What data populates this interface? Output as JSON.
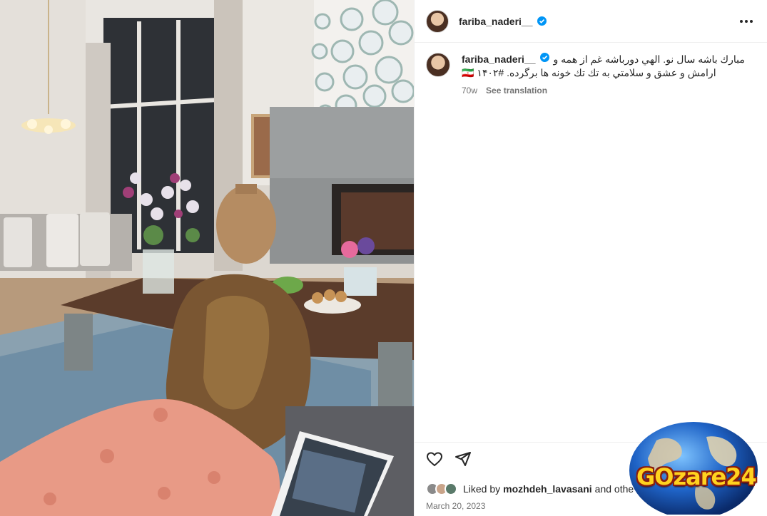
{
  "post": {
    "username": "fariba_naderi__",
    "more_icon": "more-horizontal-icon",
    "verified_icon": "verified-badge-icon"
  },
  "caption": {
    "username": "fariba_naderi__",
    "line1": "مبارك باشه سال نو. الهي دورباشه غم از همه و",
    "line2": "ارامش و عشق و سلامتي به تك تك خونه ها برگرده. #۱۴۰۲ 🇮🇷",
    "time": "70w",
    "see_translation": "See translation"
  },
  "actions": {
    "like_icon": "heart-icon",
    "share_icon": "send-icon",
    "save_icon": "bookmark-icon"
  },
  "likes": {
    "prefix": "Liked by",
    "user": "mozhdeh_lavasani",
    "suffix": "and othe"
  },
  "date": "March 20, 2023",
  "watermark": {
    "text": "GOzare24"
  },
  "colors": {
    "verified": "#0095f6",
    "text": "#262626",
    "muted": "#737373",
    "dress": "#e89a86"
  }
}
